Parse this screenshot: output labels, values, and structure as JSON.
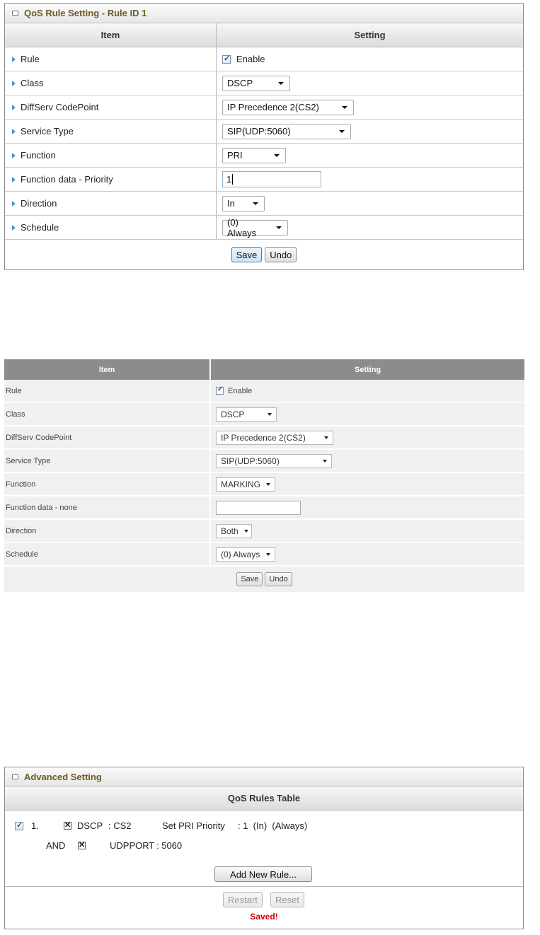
{
  "panel1": {
    "title": "QoS Rule Setting - Rule ID 1",
    "header_item": "Item",
    "header_setting": "Setting",
    "rows": [
      {
        "label": "Rule",
        "checkbox_label": "Enable"
      },
      {
        "label": "Class",
        "value": "DSCP"
      },
      {
        "label": "DiffServ CodePoint",
        "value": "IP Precedence 2(CS2)"
      },
      {
        "label": "Service Type",
        "value": "SIP(UDP:5060)"
      },
      {
        "label": "Function",
        "value": "PRI"
      },
      {
        "label": "Function data - Priority",
        "value": "1"
      },
      {
        "label": "Direction",
        "value": "In"
      },
      {
        "label": "Schedule",
        "value": "(0) Always"
      }
    ],
    "save_label": "Save",
    "undo_label": "Undo"
  },
  "panel2": {
    "header_item": "Item",
    "header_setting": "Setting",
    "rows": [
      {
        "label": "Rule",
        "checkbox_label": "Enable"
      },
      {
        "label": "Class",
        "value": "DSCP"
      },
      {
        "label": "DiffServ CodePoint",
        "value": "IP Precedence 2(CS2)"
      },
      {
        "label": "Service Type",
        "value": "SIP(UDP:5060)"
      },
      {
        "label": "Function",
        "value": "MARKING"
      },
      {
        "label": "Function data - none",
        "value": ""
      },
      {
        "label": "Direction",
        "value": "Both"
      },
      {
        "label": "Schedule",
        "value": "(0) Always"
      }
    ],
    "save_label": "Save",
    "undo_label": "Undo"
  },
  "panel3": {
    "title": "Advanced Setting",
    "table_title": "QoS Rules Table",
    "rule": {
      "index": "1.",
      "cond1_name": "DSCP",
      "cond1_value": ": CS2",
      "action": "Set PRI Priority",
      "action_value": ": 1  (In)  (Always)",
      "and_label": "AND",
      "cond2_name": "UDPPORT",
      "cond2_value": ": 5060"
    },
    "add_rule_label": "Add New Rule...",
    "restart_label": "Restart",
    "reset_label": "Reset",
    "status_text": "Saved!",
    "status_color": "#d40000"
  }
}
